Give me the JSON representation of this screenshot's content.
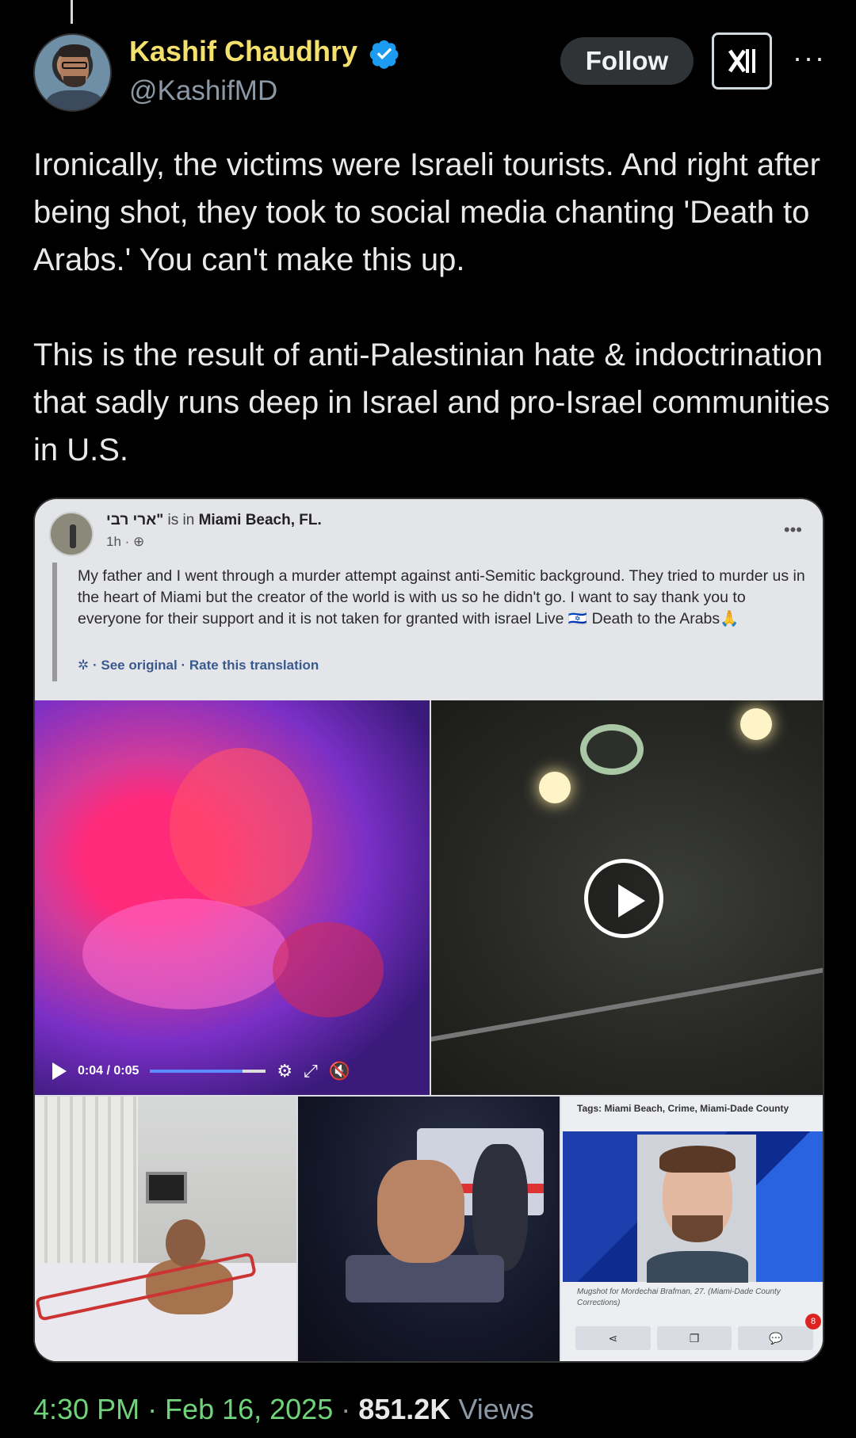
{
  "author": {
    "name": "Kashif Chaudhry",
    "handle": "@KashifMD",
    "verified": true
  },
  "actions": {
    "follow_label": "Follow",
    "grok_icon": "grok-icon",
    "more_icon": "more-options-icon"
  },
  "tweet": {
    "paragraph1": "Ironically, the victims were Israeli tourists. And right after being shot, they took to social media chanting 'Death to Arabs.' You can't make this up.",
    "paragraph2": "This is the result of anti-Palestinian hate & indoctrination that sadly runs deep in Israel and pro-Israel communities in U.S."
  },
  "embedded_post": {
    "author": "ארי רבי\"",
    "location_prefix": "is in",
    "location": "Miami Beach, FL.",
    "time": "1h ·",
    "text": "My father and I went through a murder attempt against anti-Semitic background. They tried to murder us in the heart of Miami but the creator of the world is with us so he didn't go. I want to say thank you to everyone for their support and it is not taken for granted with israel Live 🇮🇱 Death to the Arabs🙏",
    "links": "· See original · Rate this translation",
    "video_time": "0:04 / 0:05",
    "video_progress": 0.8
  },
  "news_clip": {
    "tags": "Tags: Miami Beach, Crime, Miami-Dade County",
    "caption": "Mugshot for Mordechai Brafman, 27. (Miami-Dade County Corrections)",
    "badge": "8"
  },
  "meta": {
    "time": "4:30 PM · Feb 16, 2025",
    "separator": " · ",
    "views_count": "851.2K",
    "views_label": " Views"
  },
  "colors": {
    "background": "#000000",
    "name": "#f4e06d",
    "handle": "#8b98a5",
    "verified": "#1d9bf0",
    "time_link": "#6fd37a"
  }
}
